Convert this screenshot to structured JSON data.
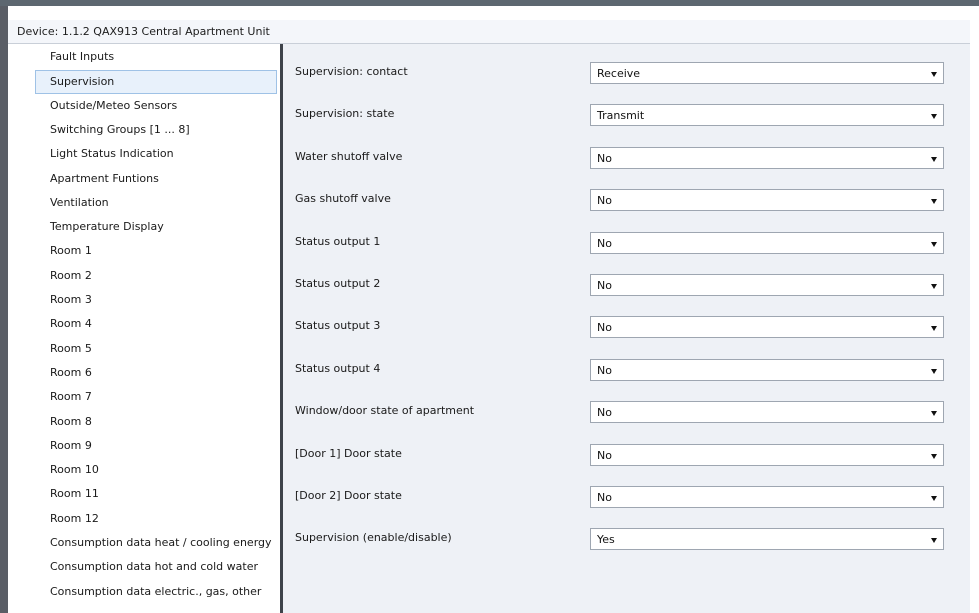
{
  "window": {
    "title": "Device: 1.1.2  QAX913 Central Apartment Unit"
  },
  "sidebar": {
    "selected_index": 1,
    "items": [
      {
        "label": "Fault Inputs"
      },
      {
        "label": "Supervision"
      },
      {
        "label": "Outside/Meteo Sensors"
      },
      {
        "label": "Switching Groups [1 ... 8]"
      },
      {
        "label": "Light Status Indication"
      },
      {
        "label": "Apartment Funtions"
      },
      {
        "label": "Ventilation"
      },
      {
        "label": "Temperature Display"
      },
      {
        "label": "Room 1"
      },
      {
        "label": "Room 2"
      },
      {
        "label": "Room 3"
      },
      {
        "label": "Room 4"
      },
      {
        "label": "Room 5"
      },
      {
        "label": "Room 6"
      },
      {
        "label": "Room 7"
      },
      {
        "label": "Room 8"
      },
      {
        "label": "Room 9"
      },
      {
        "label": "Room 10"
      },
      {
        "label": "Room 11"
      },
      {
        "label": "Room 12"
      },
      {
        "label": "Consumption data heat / cooling energy"
      },
      {
        "label": "Consumption data hot and cold water"
      },
      {
        "label": "Consumption data electric., gas, other"
      }
    ]
  },
  "parameters": [
    {
      "label": "Supervision: contact",
      "value": "Receive"
    },
    {
      "label": "Supervision: state",
      "value": "Transmit"
    },
    {
      "label": "Water shutoff valve",
      "value": "No"
    },
    {
      "label": "Gas shutoff valve",
      "value": "No"
    },
    {
      "label": "Status output 1",
      "value": "No"
    },
    {
      "label": "Status output 2",
      "value": "No"
    },
    {
      "label": "Status output 3",
      "value": "No"
    },
    {
      "label": "Status output 4",
      "value": "No"
    },
    {
      "label": "Window/door state of apartment",
      "value": "No"
    },
    {
      "label": "[Door 1] Door state",
      "value": "No"
    },
    {
      "label": "[Door 2] Door state",
      "value": "No"
    },
    {
      "label": "Supervision (enable/disable)",
      "value": "Yes"
    }
  ],
  "icons": {
    "dropdown": "chevron-down-icon"
  },
  "colors": {
    "selection_background": "#e8f1fb",
    "selection_border": "#9fc2e6",
    "panel_background": "#eef1f6"
  }
}
